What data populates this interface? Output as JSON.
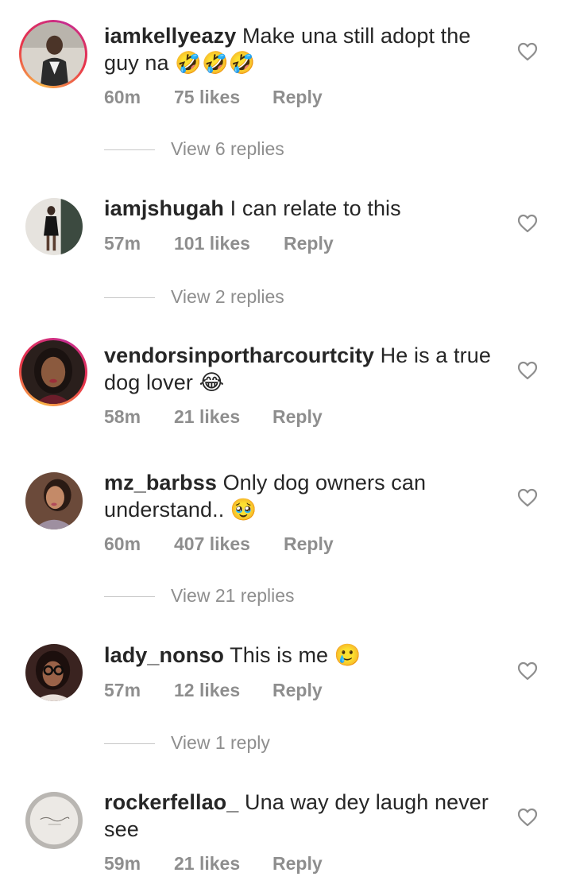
{
  "comments": [
    {
      "username": "iamkellyeazy",
      "text": "Make una still adopt the guy na 🤣🤣🤣",
      "time": "60m",
      "likes": "75 likes",
      "reply_label": "Reply",
      "view_replies": "View 6 replies",
      "story_ring": true
    },
    {
      "username": "iamjshugah",
      "text": "I can relate to this",
      "time": "57m",
      "likes": "101 likes",
      "reply_label": "Reply",
      "view_replies": "View 2 replies",
      "story_ring": false
    },
    {
      "username": "vendorsinportharcourtcity",
      "text": "He is a true dog lover 😂",
      "time": "58m",
      "likes": "21 likes",
      "reply_label": "Reply",
      "view_replies": "",
      "story_ring": true
    },
    {
      "username": "mz_barbss",
      "text": "Only dog owners can understand.. 🥹",
      "time": "60m",
      "likes": "407 likes",
      "reply_label": "Reply",
      "view_replies": "View 21 replies",
      "story_ring": false
    },
    {
      "username": "lady_nonso",
      "text": "This is me 🥲",
      "time": "57m",
      "likes": "12 likes",
      "reply_label": "Reply",
      "view_replies": "View 1 reply",
      "story_ring": false
    },
    {
      "username": "rockerfellao_",
      "text": "Una way dey laugh never see",
      "time": "59m",
      "likes": "21 likes",
      "reply_label": "Reply",
      "view_replies": "",
      "story_ring": false
    }
  ],
  "icons": {
    "like": "heart-outline-icon",
    "avatar": "user-avatar"
  },
  "colors": {
    "username": "#262626",
    "meta": "#8e8e8e",
    "divider": "#c7c7c7"
  }
}
